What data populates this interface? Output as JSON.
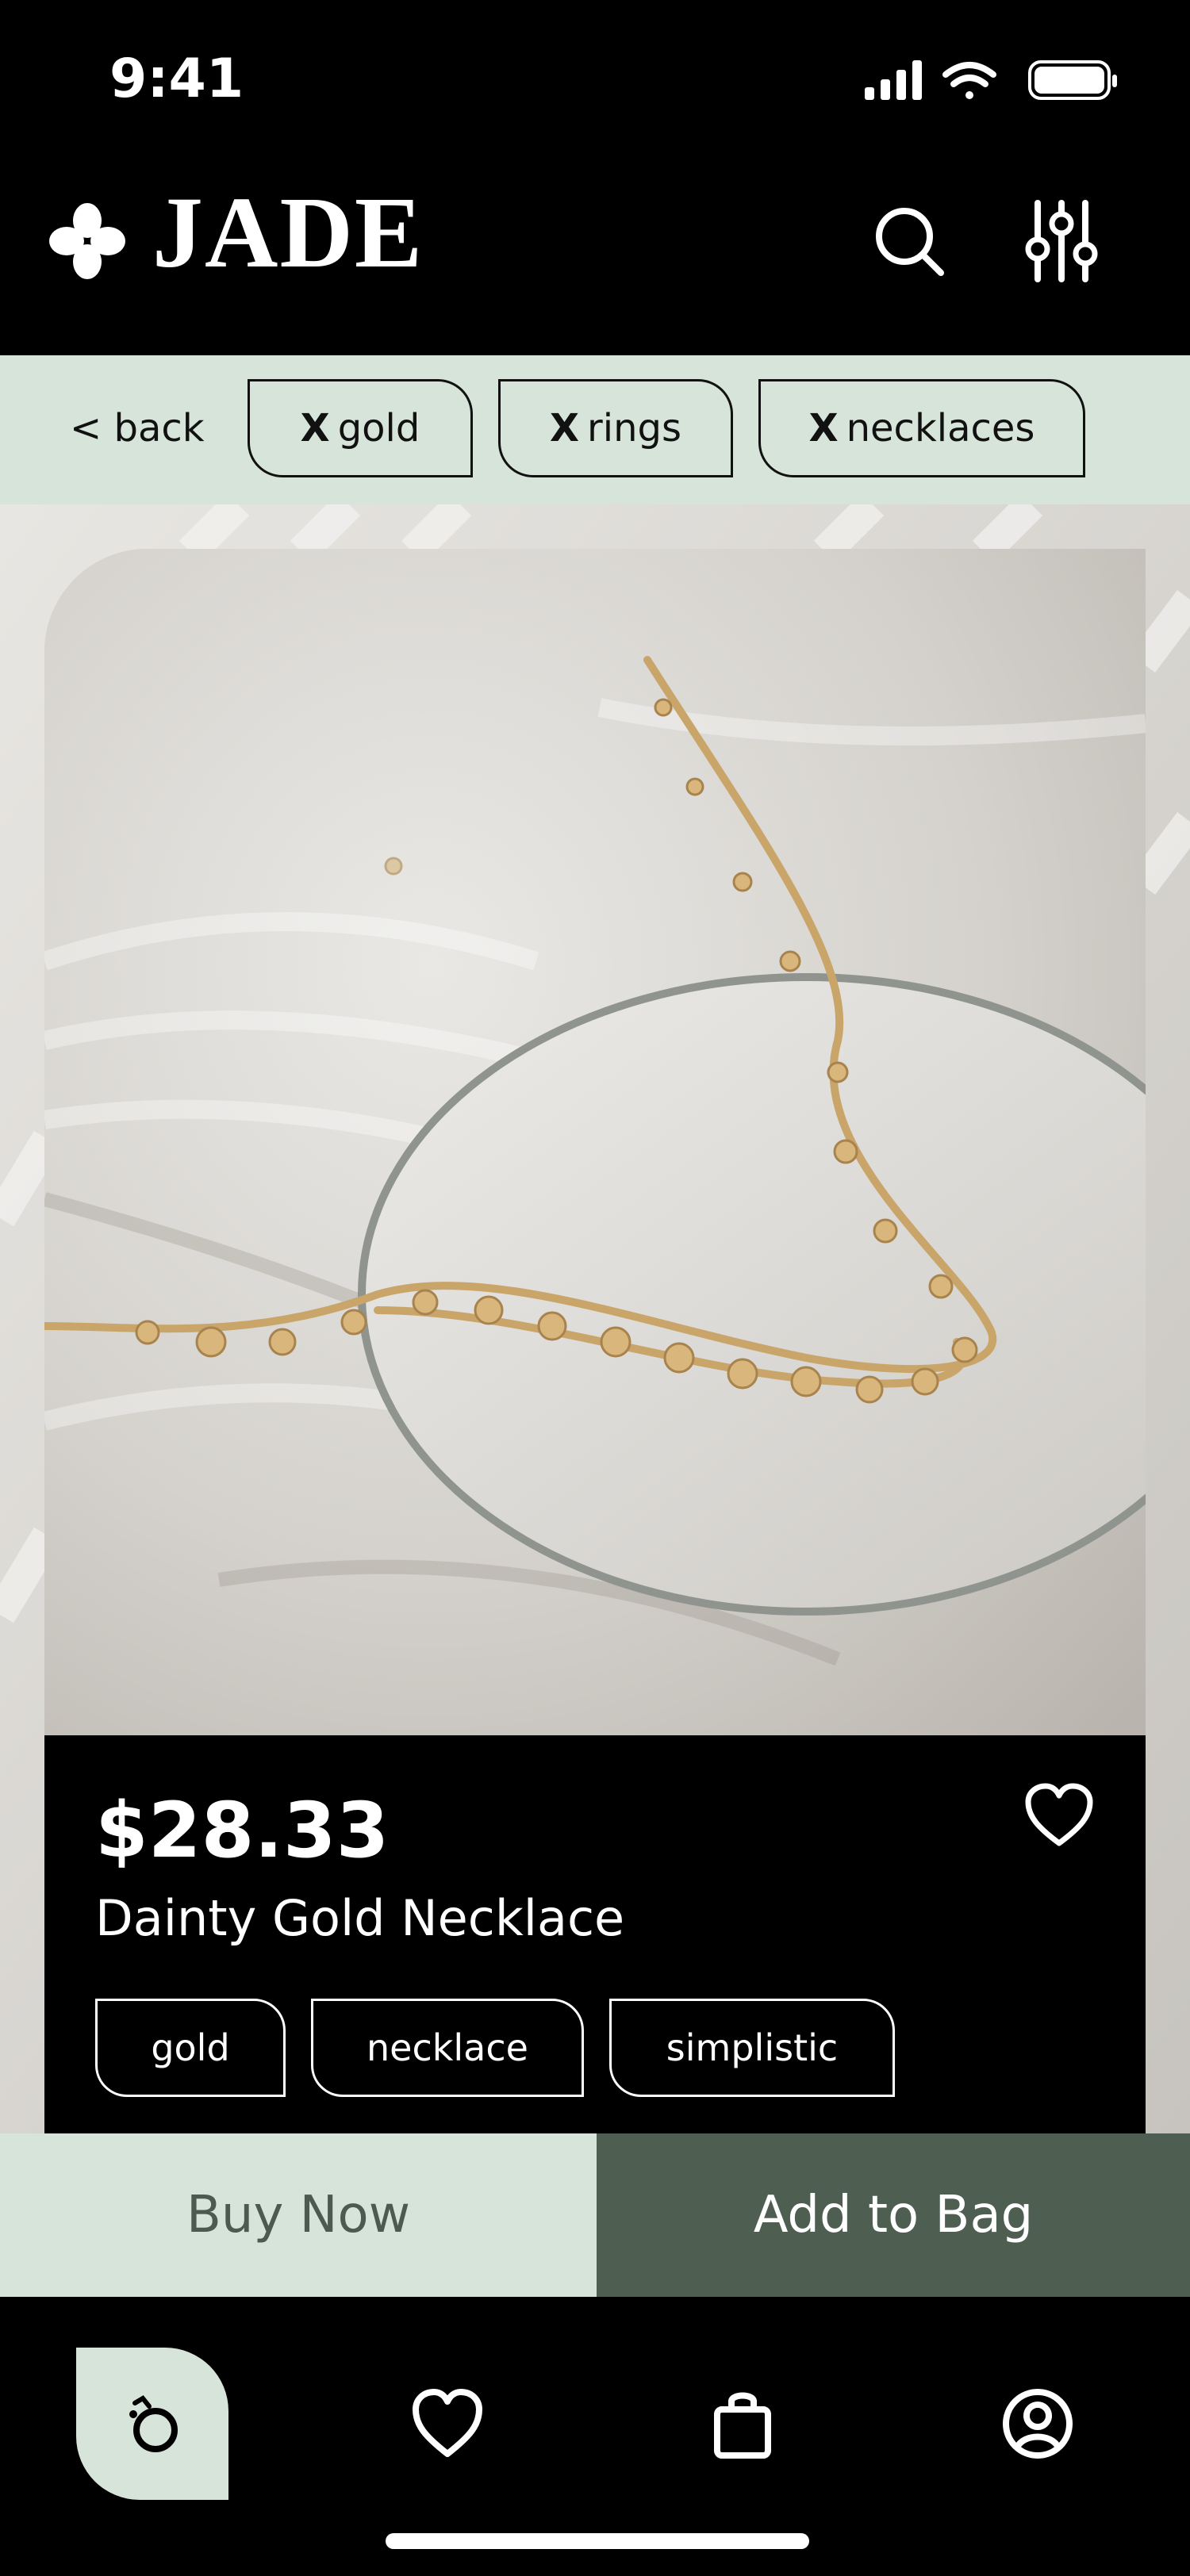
{
  "status": {
    "time": "9:41"
  },
  "header": {
    "brand": "JADE"
  },
  "filters": {
    "back_label": "< back",
    "chips": [
      {
        "x": "X",
        "label": "gold"
      },
      {
        "x": "X",
        "label": "rings"
      },
      {
        "x": "X",
        "label": "necklaces"
      }
    ]
  },
  "product": {
    "price": "$28.33",
    "name": "Dainty Gold Necklace",
    "tags": [
      "gold",
      "necklace",
      "simplistic"
    ]
  },
  "actions": {
    "buy_now": "Buy Now",
    "add_to_bag": "Add to Bag"
  },
  "colors": {
    "mint": "#d6e4da",
    "sage": "#4e5f52",
    "gold": "#c9a56a"
  }
}
